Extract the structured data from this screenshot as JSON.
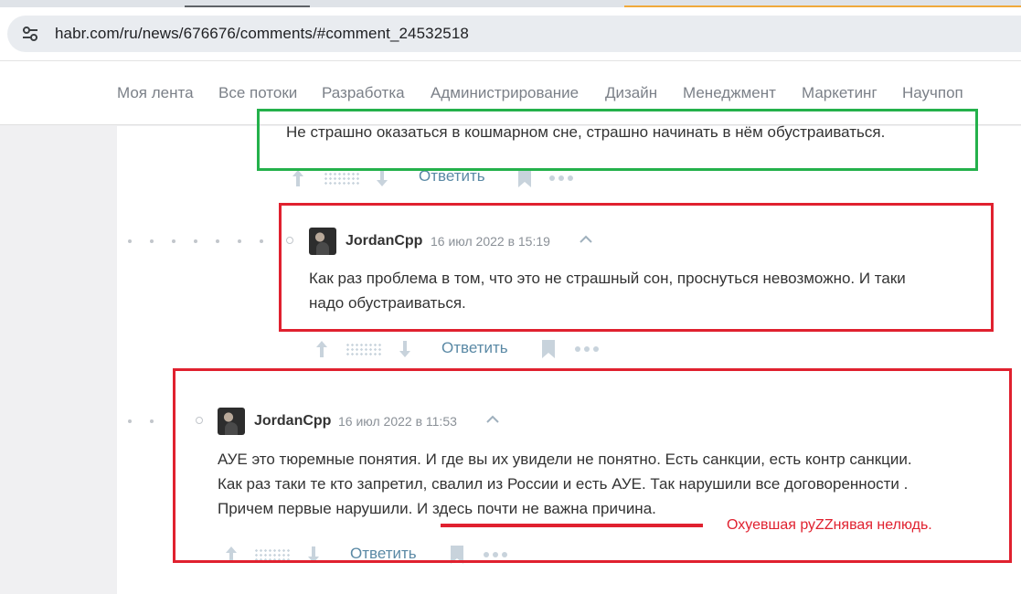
{
  "browser": {
    "url": "habr.com/ru/news/676676/comments/#comment_24532518",
    "site_info_icon": "tune-icon"
  },
  "nav": {
    "items": [
      "Моя лента",
      "Все потоки",
      "Разработка",
      "Администрирование",
      "Дизайн",
      "Менеджмент",
      "Маркетинг",
      "Научпоп"
    ]
  },
  "comments": [
    {
      "text": "Не страшно оказаться в кошмарном сне, страшно начинать в нём обустраиваться.",
      "reply_label": "Ответить"
    },
    {
      "author": "JordanCpp",
      "date": "16 июл 2022 в 15:19",
      "text_lines": [
        "Как раз проблема в том, что это не страшный сон, проснуться невозможно. И таки",
        "надо обустраиваться."
      ],
      "reply_label": "Ответить"
    },
    {
      "author": "JordanCpp",
      "date": "16 июл 2022 в 11:53",
      "text_lines": [
        "АУЕ это тюремные понятия. И где вы их увидели не понятно. Есть санкции, есть контр санкции.",
        "Как раз таки те кто запретил, свалил из России и есть АУЕ. Так нарушили все договоренности .",
        "Причем первые нарушили. И здесь почти не важна причина."
      ],
      "reply_label": "Ответить"
    }
  ],
  "annotation": {
    "text": "Охуевшая руZZнявая нелюдь.",
    "color": "#e0212f"
  },
  "colors": {
    "highlight_green": "#24b14b",
    "highlight_red": "#e0212f",
    "link": "#5a89a5"
  }
}
